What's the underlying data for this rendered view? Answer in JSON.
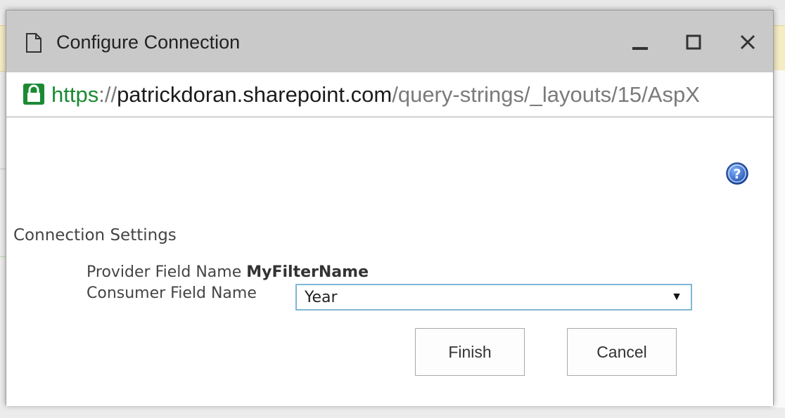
{
  "window": {
    "title": "Configure Connection"
  },
  "address_bar": {
    "scheme": "https",
    "separator": "://",
    "host": "patrickdoran.sharepoint.com",
    "path": "/query-strings/_layouts/15/AspX"
  },
  "connection_settings": {
    "heading": "Connection Settings",
    "provider_label": "Provider Field Name",
    "provider_value": "MyFilterName",
    "consumer_label": "Consumer Field Name",
    "consumer_selected": "Year"
  },
  "actions": {
    "finish_label": "Finish",
    "cancel_label": "Cancel"
  },
  "colors": {
    "secure_green": "#1a8a33",
    "titlebar": "#c9c9c9",
    "select_focus_border": "#7fb7d9",
    "help_blue": "#1f66c9"
  },
  "icons": {
    "document": "document-icon",
    "minimize": "minimize-icon",
    "maximize": "maximize-icon",
    "close": "close-icon",
    "lock": "lock-icon",
    "help": "help-icon",
    "dropdown": "chevron-down-icon"
  }
}
